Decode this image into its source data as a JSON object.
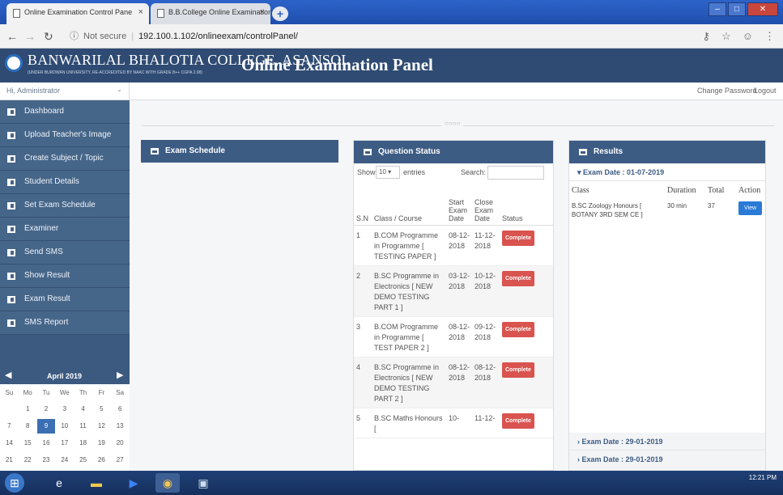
{
  "browser": {
    "tabs": [
      {
        "title": "Online Examination Control Pane",
        "active": true
      },
      {
        "title": "B.B.College Online Examination",
        "active": false
      }
    ],
    "url_secure": "Not secure",
    "url": "192.100.1.102/onlineexam/controlPanel/"
  },
  "header": {
    "college": "BANWARILAL BHALOTIA COLLEGE, ASANSOL",
    "college_sub": "(UNDER BURDWAN UNIVERSITY, RE-ACCREDITED BY NAAC WITH GRADE B++ CGPA 2.98)",
    "panel_title": "Online Examination Panel",
    "user": "Hi, Administrator",
    "change_password": "Change Password",
    "logout": "Logout"
  },
  "sidebar": {
    "items": [
      {
        "label": "Dashboard"
      },
      {
        "label": "Upload Teacher's Image"
      },
      {
        "label": "Create Subject / Topic"
      },
      {
        "label": "Student Details"
      },
      {
        "label": "Set Exam Schedule"
      },
      {
        "label": "Examiner"
      },
      {
        "label": "Send SMS"
      },
      {
        "label": "Show Result"
      },
      {
        "label": "Exam Result"
      },
      {
        "label": "SMS Report"
      }
    ],
    "calendar": {
      "title": "April 2019",
      "weekdays": [
        "Su",
        "Mo",
        "Tu",
        "We",
        "Th",
        "Fr",
        "Sa"
      ],
      "weeks": [
        [
          "",
          "1",
          "2",
          "3",
          "4",
          "5",
          "6"
        ],
        [
          "7",
          "8",
          "9",
          "10",
          "11",
          "12",
          "13"
        ],
        [
          "14",
          "15",
          "16",
          "17",
          "18",
          "19",
          "20"
        ],
        [
          "21",
          "22",
          "23",
          "24",
          "25",
          "26",
          "27"
        ]
      ],
      "today": "9"
    }
  },
  "exam_schedule": {
    "title": "Exam Schedule"
  },
  "question_status": {
    "title": "Question Status",
    "show_label": "Show",
    "show_value": "10",
    "entries_label": "entries",
    "search_label": "Search:",
    "columns": [
      "S.N",
      "Class / Course",
      "Start Exam Date",
      "Close Exam Date",
      "Status"
    ],
    "rows": [
      {
        "sn": "1",
        "course": "B.COM Programme in Programme [ TESTING PAPER ]",
        "start": "08-12-2018",
        "close": "11-12-2018",
        "status": "Complete"
      },
      {
        "sn": "2",
        "course": "B.SC Programme in Electronics [ NEW DEMO TESTING PART 1 ]",
        "start": "03-12-2018",
        "close": "10-12-2018",
        "status": "Complete"
      },
      {
        "sn": "3",
        "course": "B.COM Programme in Programme [ TEST PAPER 2 ]",
        "start": "08-12-2018",
        "close": "09-12-2018",
        "status": "Complete"
      },
      {
        "sn": "4",
        "course": "B.SC Programme in Electronics [ NEW DEMO TESTING PART 2 ]",
        "start": "08-12-2018",
        "close": "08-12-2018",
        "status": "Complete"
      },
      {
        "sn": "5",
        "course": "B.SC Maths Honours [",
        "start": "10-",
        "close": "11-12-",
        "status": "Complete"
      }
    ]
  },
  "results": {
    "title": "Results",
    "date1": "Exam Date : 01-07-2019",
    "columns": [
      "Class",
      "Duration",
      "Total",
      "Action"
    ],
    "rows": [
      {
        "class": "B.SC Zoology Honours [ BOTANY 3RD SEM CE ]",
        "duration": "30 min",
        "total": "37",
        "action": "View"
      }
    ],
    "date2": "Exam Date : 29-01-2019",
    "date3": "Exam Date : 29-01-2019"
  },
  "taskbar": {
    "time": "12:21 PM"
  }
}
